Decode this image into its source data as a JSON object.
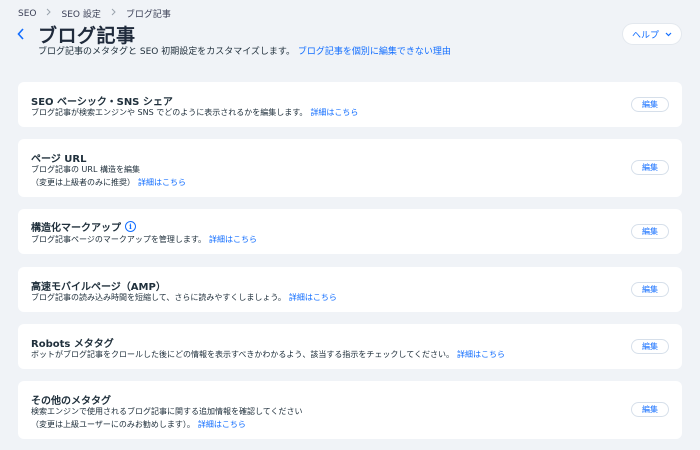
{
  "breadcrumb": [
    "SEO",
    "SEO 設定",
    "ブログ記事"
  ],
  "header": {
    "title": "ブログ記事",
    "subtitle": "ブログ記事のメタタグと SEO 初期設定をカスタマイズします。",
    "subtitle_link": "ブログ記事を個別に編集できない理由",
    "help_label": "ヘルプ"
  },
  "cards": [
    {
      "title": "SEO ベーシック・SNS シェア",
      "desc": [
        "ブログ記事が検索エンジンや SNS でどのように表示されるかを編集します。"
      ],
      "link": "詳細はこちら",
      "edit": "編集"
    },
    {
      "title": "ページ URL",
      "desc": [
        "ブログ記事の URL 構造を編集",
        "（変更は上級者のみに推奨）"
      ],
      "link": "詳細はこちら",
      "edit": "編集"
    },
    {
      "title": "構造化マークアップ",
      "info_icon": "info-icon",
      "desc": [
        "ブログ記事ページのマークアップを管理します。"
      ],
      "link": "詳細はこちら",
      "edit": "編集"
    },
    {
      "title": "高速モバイルページ（AMP）",
      "desc": [
        "ブログ記事の読み込み時間を短縮して、さらに読みやすくしましょう。"
      ],
      "link": "詳細はこちら",
      "edit": "編集"
    },
    {
      "title": "Robots メタタグ",
      "desc": [
        "ボットがブログ記事をクロールした後にどの情報を表示すべきかわかるよう、該当する指示をチェックしてください。"
      ],
      "link": "詳細はこちら",
      "edit": "編集"
    },
    {
      "title": "その他のメタタグ",
      "desc": [
        "検索エンジンで使用されるブログ記事に関する追加情報を確認してください",
        "（変更は上級ユーザーにのみお勧めします）。"
      ],
      "link": "詳細はこちら",
      "edit": "編集"
    }
  ],
  "colors": {
    "accent": "#116dff",
    "background": "#f0f3f7",
    "card": "#ffffff",
    "text": "#20303c"
  }
}
